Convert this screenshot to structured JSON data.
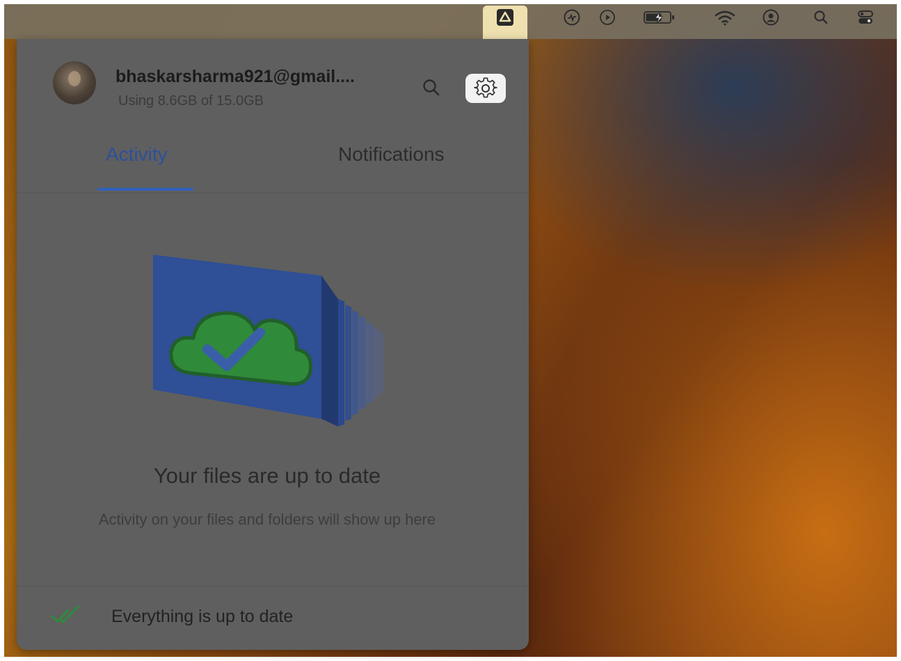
{
  "menubar": {
    "icons": [
      "google-drive-icon",
      "activity-monitor-icon",
      "play-icon",
      "battery-icon",
      "wifi-icon",
      "user-icon",
      "search-icon",
      "control-center-icon"
    ]
  },
  "panel": {
    "account": {
      "email": "bhaskarsharma921@gmail....",
      "storage": "Using 8.6GB of 15.0GB"
    },
    "tabs": [
      {
        "label": "Activity",
        "active": true
      },
      {
        "label": "Notifications",
        "active": false
      }
    ],
    "empty_state": {
      "title": "Your files are up to date",
      "subtitle": "Activity on your files and folders will show up here"
    },
    "footer": {
      "status": "Everything is up to date"
    }
  },
  "colors": {
    "accent": "#2f62c0",
    "panel_bg": "#5f5f5f",
    "cloud_green": "#2f8a3a",
    "folder_blue": "#2f4f96"
  }
}
